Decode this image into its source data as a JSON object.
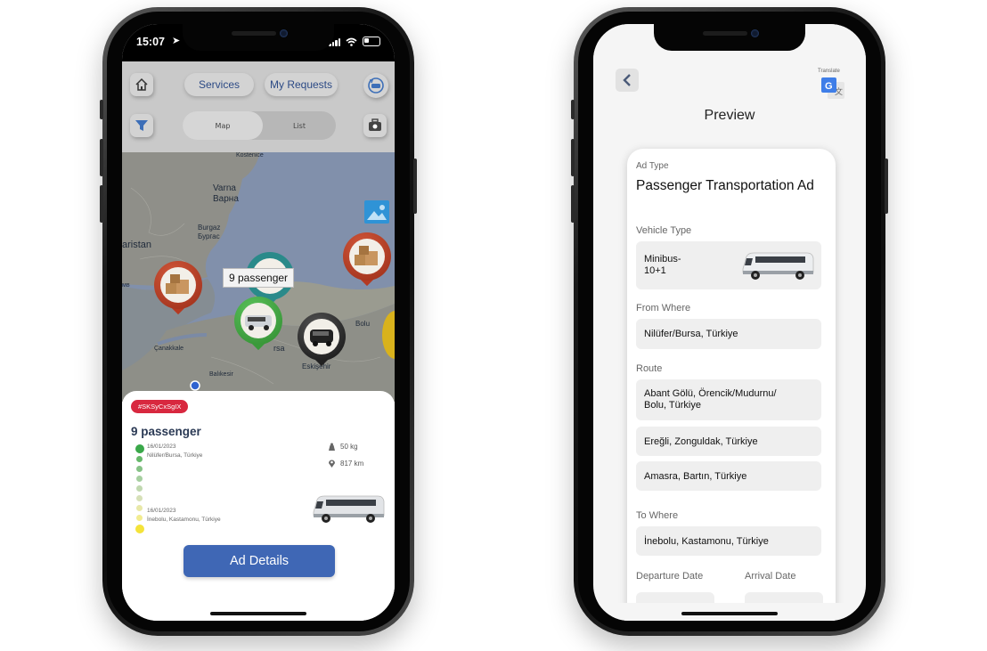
{
  "left_phone": {
    "status": {
      "time": "15:07"
    },
    "header": {
      "services_tab": "Services",
      "requests_tab": "My Requests",
      "view_toggle": {
        "map": "Map",
        "list": "List",
        "selected": "Map"
      }
    },
    "map": {
      "labels": {
        "kosterice": "Kostenice",
        "varna_latin": "Varna",
        "varna_cyrillic": "Варна",
        "burgaz_latin": "Burgaz",
        "burgaz_cyrillic": "Бургас",
        "aristan": "aristan",
        "mb": "мв",
        "canakkale": "Çanakkale",
        "balikesir": "Balıkesir",
        "bolu": "Bolu",
        "bursa_fragment": "rsa",
        "eskisehir": "Eskişehir"
      },
      "tooltip": "9 passenger"
    },
    "card": {
      "tag": "#SKSyCxSgIX",
      "title": "9 passenger",
      "start": {
        "date": "16/01/2023",
        "place": "Nilüfer/Bursa, Türkiye"
      },
      "end": {
        "date": "16/01/2023",
        "place": "İnebolu, Kastamonu, Türkiye"
      },
      "weight": "50 kg",
      "distance": "817 km",
      "button": "Ad Details"
    }
  },
  "right_phone": {
    "translate_label": "Translate",
    "title": "Preview",
    "ad_type": {
      "label": "Ad Type",
      "value": "Passenger Transportation Ad"
    },
    "vehicle_type": {
      "label": "Vehicle Type",
      "line1": "Minibus-",
      "line2": "10+1"
    },
    "from_where": {
      "label": "From Where",
      "value": "Nilüfer/Bursa, Türkiye"
    },
    "route": {
      "label": "Route",
      "stop1_line1": "Abant Gölü, Örencik/Mudurnu/",
      "stop1_line2": "Bolu, Türkiye",
      "stop2": "Ereğli, Zonguldak, Türkiye",
      "stop3": "Amasra, Bartın, Türkiye"
    },
    "to_where": {
      "label": "To Where",
      "value": "İnebolu, Kastamonu, Türkiye"
    },
    "departure_label": "Departure Date",
    "arrival_label": "Arrival Date"
  },
  "colors": {
    "accent_blue": "#3f67b5",
    "tag_red": "#d8283f",
    "pin_red": "#b43a22",
    "pin_green": "#3a9a3a",
    "pin_black": "#222222",
    "pin_teal": "#2a8a8a"
  }
}
